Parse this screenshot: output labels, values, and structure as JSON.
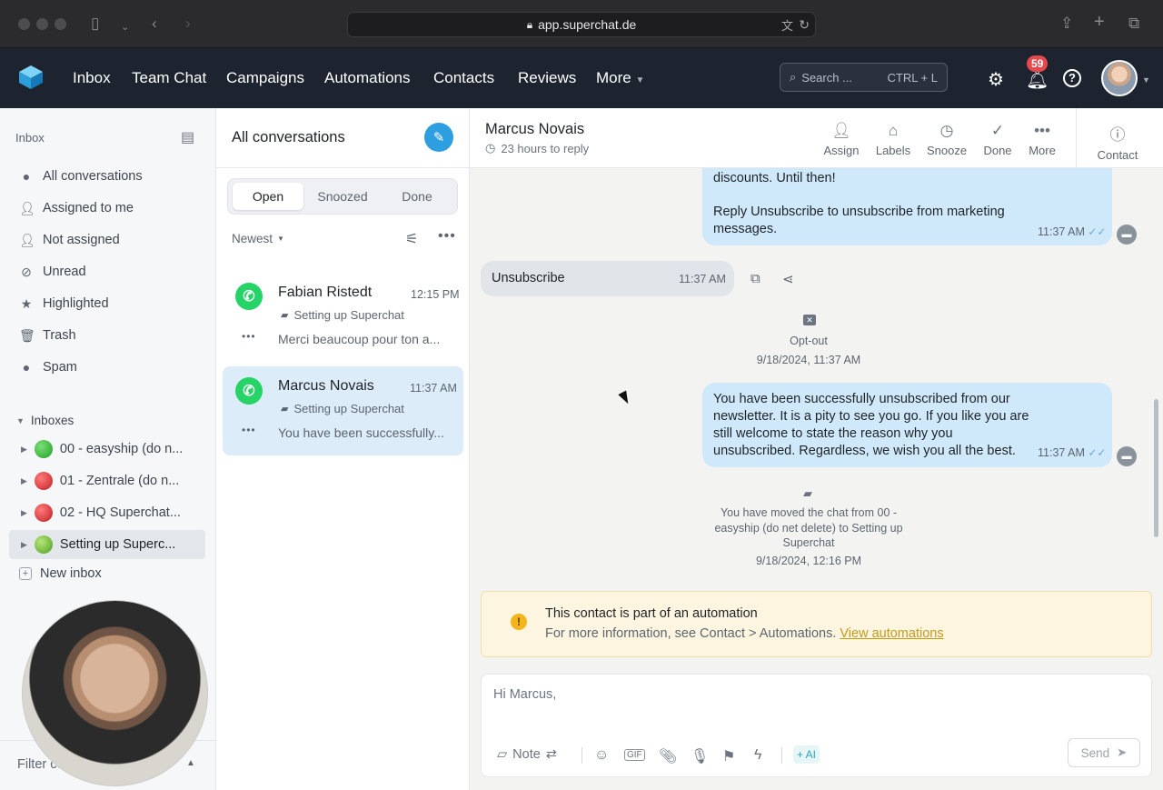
{
  "browser": {
    "url": "app.superchat.de"
  },
  "nav": {
    "items": [
      "Inbox",
      "Team Chat",
      "Campaigns",
      "Automations",
      "Contacts",
      "Reviews",
      "More"
    ],
    "search_placeholder": "Search ...",
    "search_shortcut": "CTRL + L",
    "notif_count": "59"
  },
  "sidebar": {
    "title": "Inbox",
    "items": [
      {
        "label": "All conversations",
        "icon": "chat-icon"
      },
      {
        "label": "Assigned to me",
        "icon": "user-check-icon"
      },
      {
        "label": "Not assigned",
        "icon": "user-x-icon"
      },
      {
        "label": "Unread",
        "icon": "eye-off-icon"
      },
      {
        "label": "Highlighted",
        "icon": "star-icon"
      },
      {
        "label": "Trash",
        "icon": "trash-icon"
      },
      {
        "label": "Spam",
        "icon": "alert-icon"
      }
    ],
    "inboxes_title": "Inboxes",
    "inboxes": [
      {
        "label": "00 - easyship (do n...",
        "color": "#27b327"
      },
      {
        "label": "01 - Zentrale (do n...",
        "color": "#d6262b"
      },
      {
        "label": "02 - HQ Superchat...",
        "color": "#d6262b"
      },
      {
        "label": "Setting up Superc...",
        "color": "#7dc242"
      }
    ],
    "new_inbox": "New inbox",
    "filter": "Filter co"
  },
  "convlist": {
    "title": "All conversations",
    "tabs": [
      "Open",
      "Snoozed",
      "Done"
    ],
    "sort": "Newest",
    "conversations": [
      {
        "name": "Fabian Ristedt",
        "time": "12:15 PM",
        "inbox": "Setting up Superchat",
        "preview": "Merci beaucoup pour ton a..."
      },
      {
        "name": "Marcus Novais",
        "time": "11:37 AM",
        "inbox": "Setting up Superchat",
        "preview": "You have been successfully..."
      }
    ]
  },
  "chat": {
    "contact_name": "Marcus Novais",
    "reply_status": "23 hours to reply",
    "actions": [
      "Assign",
      "Labels",
      "Snooze",
      "Done",
      "More"
    ],
    "contact_label": "Contact",
    "msg1_line1": "discounts. Until then!",
    "msg1_line2": "Reply Unsubscribe to unsubscribe from marketing",
    "msg1_line3": "messages.",
    "msg1_time": "11:37 AM",
    "msg_in": "Unsubscribe",
    "msg_in_time": "11:37 AM",
    "optout_label": "Opt-out",
    "optout_time": "9/18/2024, 11:37 AM",
    "msg2_lines": [
      "You have been successfully unsubscribed from our",
      "newsletter. It is a pity to see you go. If you like you are",
      "still welcome to state the reason why you",
      "unsubscribed. Regardless, we wish you all the best."
    ],
    "msg2_time": "11:37 AM",
    "moved_lines": [
      "You have moved the chat from 00 -",
      "easyship (do net delete) to Setting up",
      "Superchat"
    ],
    "moved_time": "9/18/2024, 12:16 PM",
    "banner_title": "This contact is part of an automation",
    "banner_text": "For more information, see Contact > Automations.",
    "banner_link": "View automations",
    "composer_text": "Hi Marcus,",
    "note_label": "Note",
    "ai_label": "+ AI",
    "send_label": "Send"
  }
}
